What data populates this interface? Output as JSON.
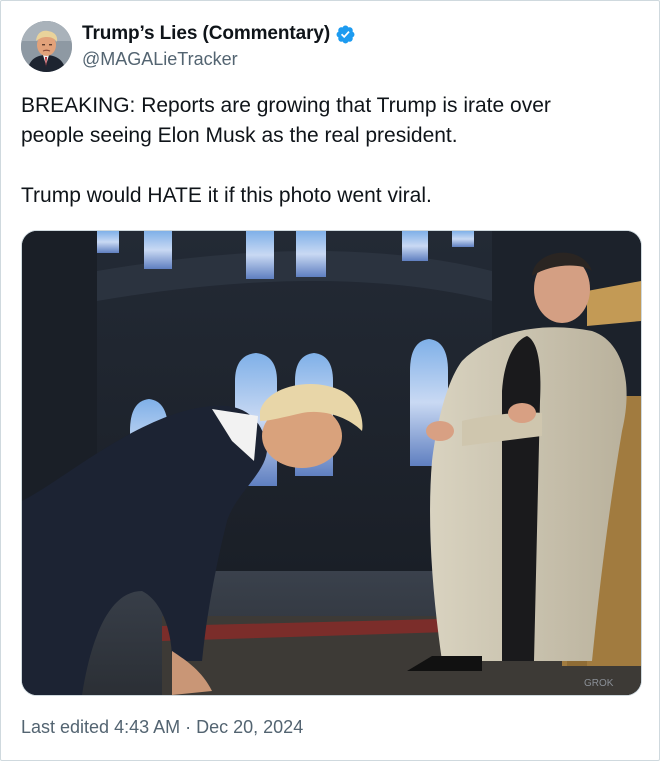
{
  "author": {
    "display_name": "Trump’s Lies (Commentary)",
    "handle": "@MAGALieTracker",
    "avatar_icon": "mugshot-avatar",
    "verified_icon": "verified-badge-icon",
    "verified_color": "#1d9bf0"
  },
  "tweet": {
    "lines": [
      "BREAKING: Reports are growing that Trump is irate over\npeople seeing Elon Musk as the real president.",
      "Trump would HATE it if this photo went viral."
    ]
  },
  "media": {
    "watermark": "GROK"
  },
  "footer": {
    "edited_label": "Last edited",
    "time": "4:43 AM",
    "separator": "·",
    "date": "Dec 20, 2024"
  }
}
